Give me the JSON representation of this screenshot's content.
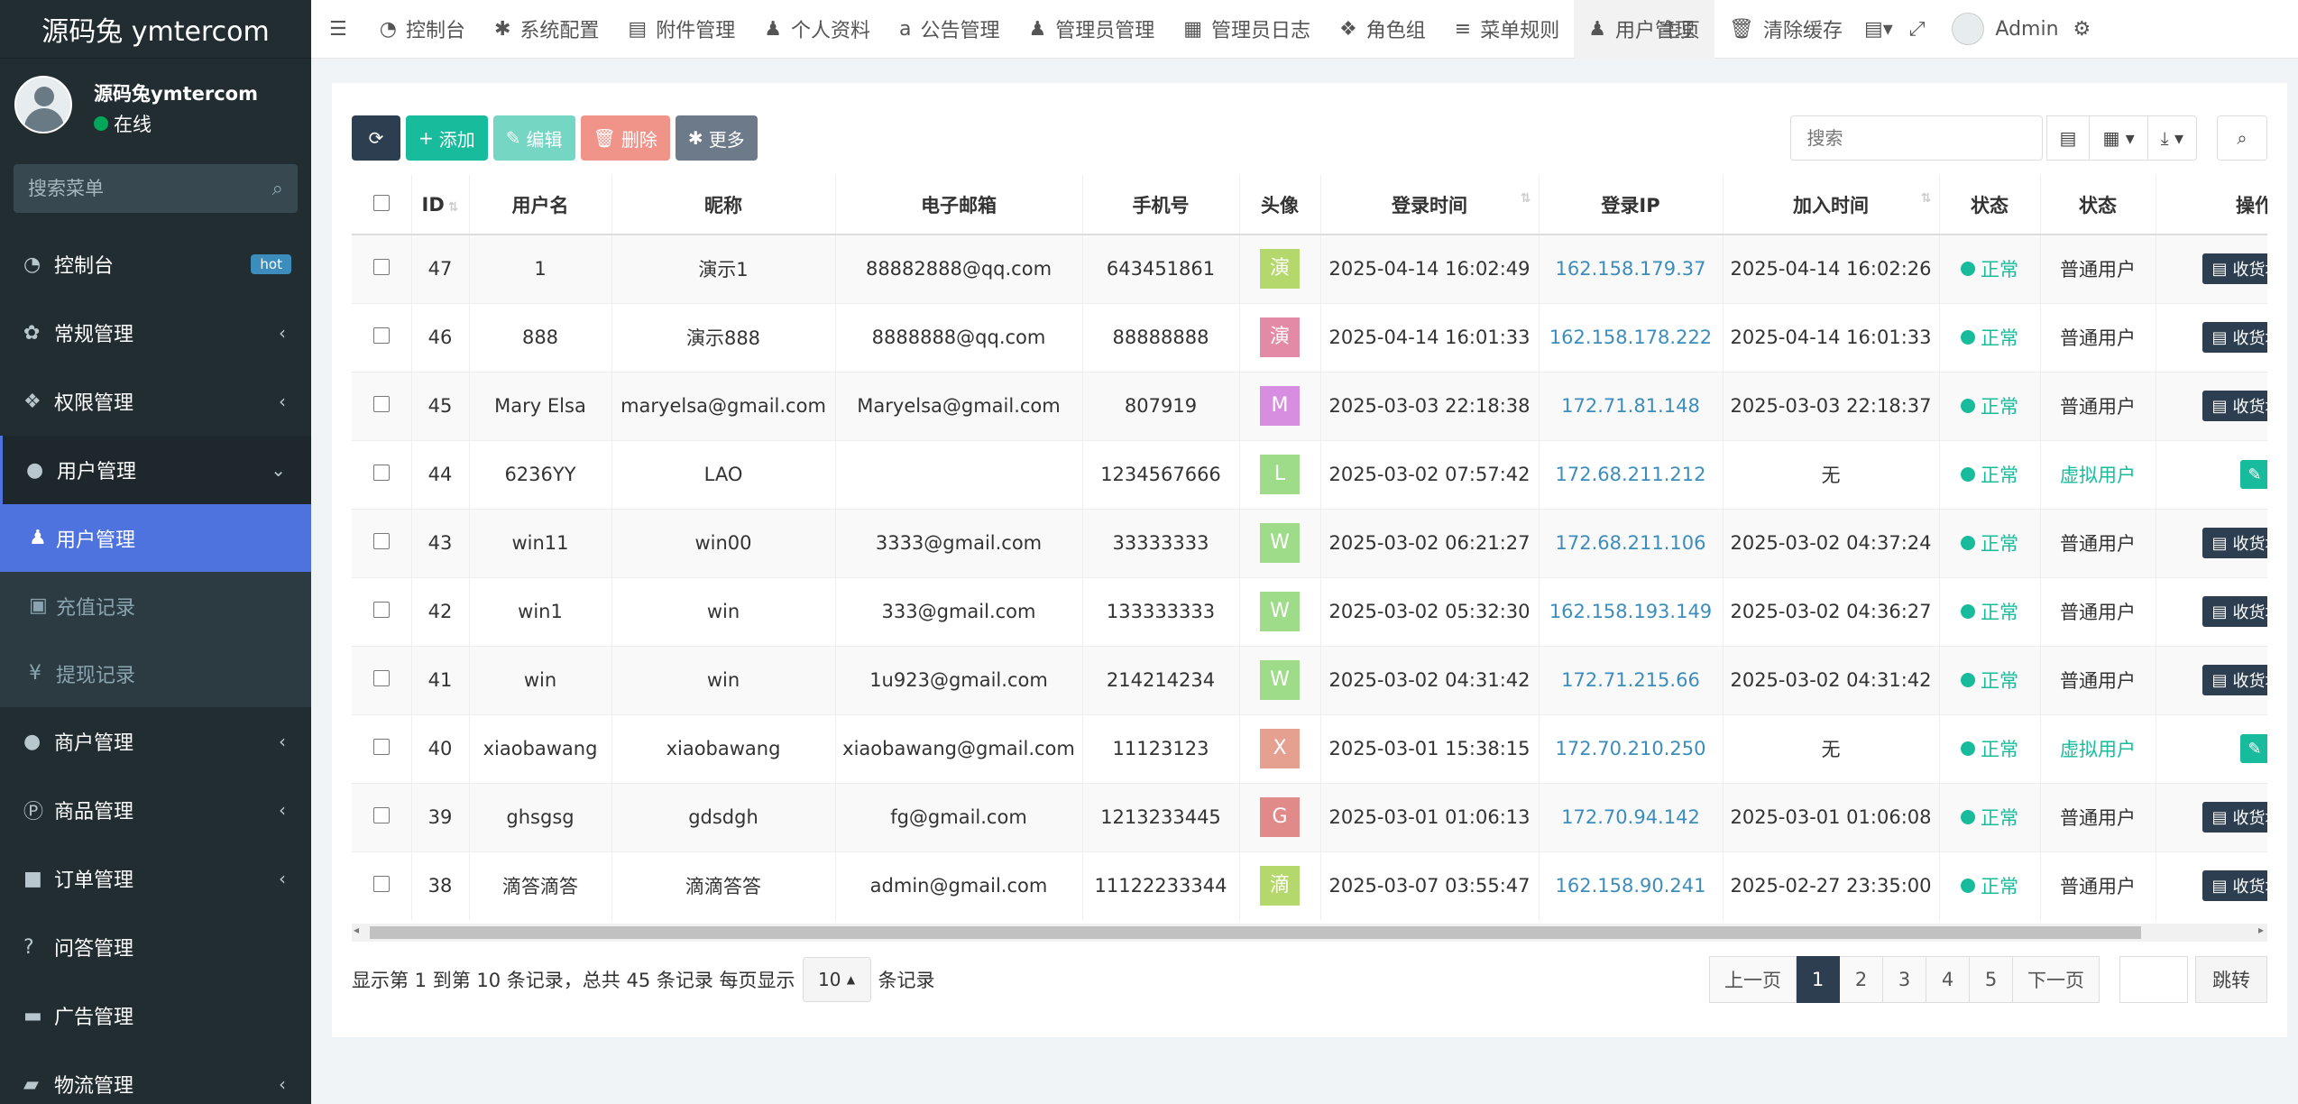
{
  "brand": "源码兔 ymtercom",
  "user": {
    "name": "源码兔ymtercom",
    "status": "在线"
  },
  "sidebar_search": {
    "placeholder": "搜索菜单"
  },
  "sidebar": {
    "items": [
      {
        "icon": "dashboard-icon",
        "glyph": "◔",
        "label": "控制台",
        "badge": "hot"
      },
      {
        "icon": "gears-icon",
        "glyph": "✿",
        "label": "常规管理"
      },
      {
        "icon": "users-icon",
        "glyph": "❖",
        "label": "权限管理"
      },
      {
        "icon": "user-circle-icon",
        "glyph": "●",
        "label": "用户管理"
      }
    ],
    "sub_items": [
      {
        "icon": "user-icon",
        "glyph": "♟",
        "label": "用户管理"
      },
      {
        "icon": "money-icon",
        "glyph": "▣",
        "label": "充值记录"
      },
      {
        "icon": "yen-icon",
        "glyph": "¥",
        "label": "提现记录"
      }
    ],
    "items_after": [
      {
        "icon": "apple-icon",
        "glyph": "●",
        "label": "商户管理"
      },
      {
        "icon": "product-icon",
        "glyph": "Ⓟ",
        "label": "商品管理"
      },
      {
        "icon": "cube-icon",
        "glyph": "■",
        "label": "订单管理"
      },
      {
        "icon": "question-icon",
        "glyph": "?",
        "label": "问答管理"
      },
      {
        "icon": "ad-icon",
        "glyph": "▬",
        "label": "广告管理"
      },
      {
        "icon": "truck-icon",
        "glyph": "▰",
        "label": "物流管理"
      }
    ]
  },
  "topbar": {
    "menu_icon": "☰",
    "tabs": [
      {
        "icon": "dashboard-icon",
        "glyph": "◔",
        "label": "控制台"
      },
      {
        "icon": "cog-icon",
        "glyph": "✱",
        "label": "系统配置"
      },
      {
        "icon": "file-icon",
        "glyph": "▤",
        "label": "附件管理"
      },
      {
        "icon": "user-icon",
        "glyph": "♟",
        "label": "个人资料"
      },
      {
        "icon": "amazon-icon",
        "glyph": "a",
        "label": "公告管理"
      },
      {
        "icon": "user-icon",
        "glyph": "♟",
        "label": "管理员管理"
      },
      {
        "icon": "list-alt-icon",
        "glyph": "▦",
        "label": "管理员日志"
      },
      {
        "icon": "group-icon",
        "glyph": "❖",
        "label": "角色组"
      },
      {
        "icon": "bars-icon",
        "glyph": "≡",
        "label": "菜单规则"
      },
      {
        "icon": "user-icon",
        "glyph": "♟",
        "label": "用户管理",
        "active": true
      }
    ],
    "home_label": "主页",
    "clear_cache": "清除缓存",
    "admin": "Admin"
  },
  "toolbar": {
    "add": "添加",
    "edit": "编辑",
    "delete": "删除",
    "more": "更多"
  },
  "table_search": {
    "placeholder": "搜索"
  },
  "table": {
    "headers": [
      "ID",
      "用户名",
      "昵称",
      "电子邮箱",
      "手机号",
      "头像",
      "登录时间",
      "登录IP",
      "加入时间",
      "状态",
      "状态",
      "操作"
    ],
    "rows": [
      {
        "id": "47",
        "username": "1",
        "nickname": "演示1",
        "email": "88882888@qq.com",
        "mobile": "643451861",
        "avatar": "演",
        "avatar_color": "#b5d86d",
        "login_time": "2025-04-14 16:02:49",
        "login_ip": "162.158.179.37",
        "join_time": "2025-04-14 16:02:26",
        "status": "正常",
        "type": "普通用户",
        "virtual": false,
        "op": "收货地址"
      },
      {
        "id": "46",
        "username": "888",
        "nickname": "演示888",
        "email": "8888888@qq.com",
        "mobile": "88888888",
        "avatar": "演",
        "avatar_color": "#e38aa6",
        "login_time": "2025-04-14 16:01:33",
        "login_ip": "162.158.178.222",
        "join_time": "2025-04-14 16:01:33",
        "status": "正常",
        "type": "普通用户",
        "virtual": false,
        "op": "收货地址"
      },
      {
        "id": "45",
        "username": "Mary Elsa",
        "nickname": "maryelsa@gmail.com",
        "email": "Maryelsa@gmail.com",
        "mobile": "807919",
        "avatar": "M",
        "avatar_color": "#d88ee0",
        "login_time": "2025-03-03 22:18:38",
        "login_ip": "172.71.81.148",
        "join_time": "2025-03-03 22:18:37",
        "status": "正常",
        "type": "普通用户",
        "virtual": false,
        "op": "收货地址"
      },
      {
        "id": "44",
        "username": "6236YY",
        "nickname": "LAO",
        "email": "",
        "mobile": "1234567666",
        "avatar": "L",
        "avatar_color": "#9fdc8a",
        "login_time": "2025-03-02 07:57:42",
        "login_ip": "172.68.211.212",
        "join_time": "无",
        "status": "正常",
        "type": "虚拟用户",
        "virtual": true,
        "op": ""
      },
      {
        "id": "43",
        "username": "win11",
        "nickname": "win00",
        "email": "3333@gmail.com",
        "mobile": "33333333",
        "avatar": "W",
        "avatar_color": "#9fdc8a",
        "login_time": "2025-03-02 06:21:27",
        "login_ip": "172.68.211.106",
        "join_time": "2025-03-02 04:37:24",
        "status": "正常",
        "type": "普通用户",
        "virtual": false,
        "op": "收货地址"
      },
      {
        "id": "42",
        "username": "win1",
        "nickname": "win",
        "email": "333@gmail.com",
        "mobile": "133333333",
        "avatar": "W",
        "avatar_color": "#9fdc8a",
        "login_time": "2025-03-02 05:32:30",
        "login_ip": "162.158.193.149",
        "join_time": "2025-03-02 04:36:27",
        "status": "正常",
        "type": "普通用户",
        "virtual": false,
        "op": "收货地址"
      },
      {
        "id": "41",
        "username": "win",
        "nickname": "win",
        "email": "1u923@gmail.com",
        "mobile": "214214234",
        "avatar": "W",
        "avatar_color": "#9fdc8a",
        "login_time": "2025-03-02 04:31:42",
        "login_ip": "172.71.215.66",
        "join_time": "2025-03-02 04:31:42",
        "status": "正常",
        "type": "普通用户",
        "virtual": false,
        "op": "收货地址"
      },
      {
        "id": "40",
        "username": "xiaobawang",
        "nickname": "xiaobawang",
        "email": "xiaobawang@gmail.com",
        "mobile": "11123123",
        "avatar": "X",
        "avatar_color": "#e6a08f",
        "login_time": "2025-03-01 15:38:15",
        "login_ip": "172.70.210.250",
        "join_time": "无",
        "status": "正常",
        "type": "虚拟用户",
        "virtual": true,
        "op": ""
      },
      {
        "id": "39",
        "username": "ghsgsg",
        "nickname": "gdsdgh",
        "email": "fg@gmail.com",
        "mobile": "1213233445",
        "avatar": "G",
        "avatar_color": "#e08a8a",
        "login_time": "2025-03-01 01:06:13",
        "login_ip": "172.70.94.142",
        "join_time": "2025-03-01 01:06:08",
        "status": "正常",
        "type": "普通用户",
        "virtual": false,
        "op": "收货地址"
      },
      {
        "id": "38",
        "username": "滴答滴答",
        "nickname": "滴滴答答",
        "email": "admin@gmail.com",
        "mobile": "11122233344",
        "avatar": "滴",
        "avatar_color": "#b5d86d",
        "login_time": "2025-03-07 03:55:47",
        "login_ip": "162.158.90.241",
        "join_time": "2025-02-27 23:35:00",
        "status": "正常",
        "type": "普通用户",
        "virtual": false,
        "op": "收货地址"
      }
    ]
  },
  "pagination": {
    "info": "显示第 1 到第 10 条记录，总共 45 条记录 每页显示",
    "page_size": "10",
    "suffix": "条记录",
    "prev": "上一页",
    "pages": [
      "1",
      "2",
      "3",
      "4",
      "5"
    ],
    "current": "1",
    "next": "下一页",
    "jump": "跳转"
  },
  "colors": {
    "sidebar_bg": "#222d32",
    "active": "#4e73df",
    "success": "#18bc9c",
    "primary_dark": "#2c3e50",
    "link": "#3c8dbc"
  }
}
